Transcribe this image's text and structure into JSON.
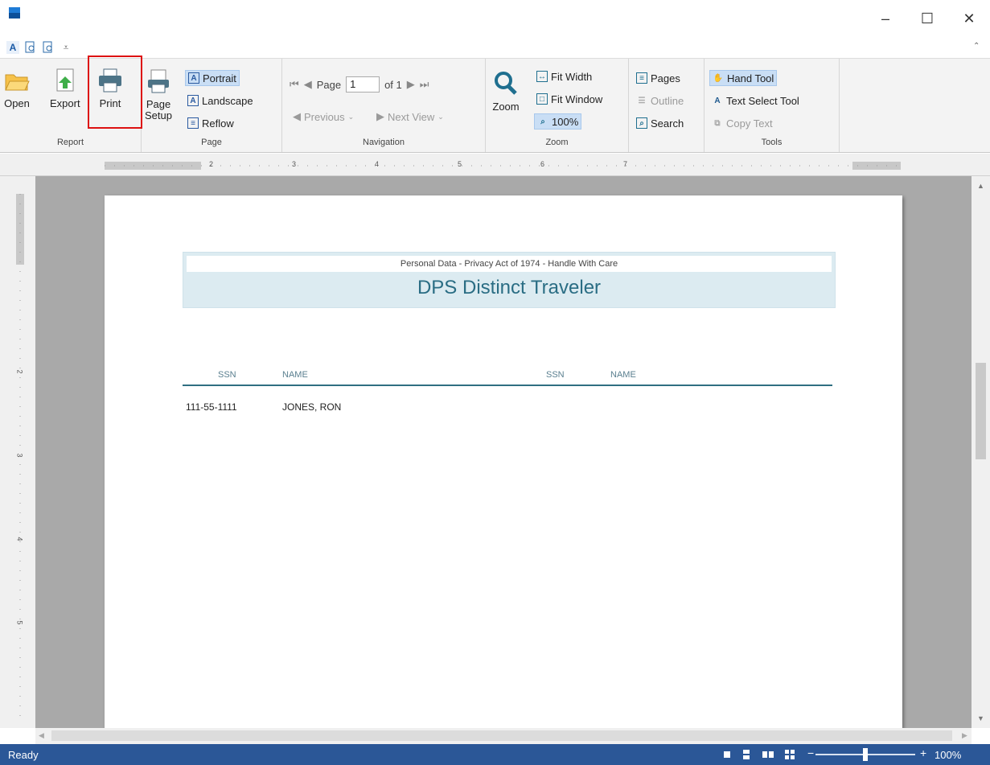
{
  "window": {
    "minimize": "–",
    "maximize": "☐",
    "close": "✕"
  },
  "ribbon": {
    "report": {
      "label": "Report",
      "open": "Open",
      "export": "Export",
      "print": "Print"
    },
    "page": {
      "label": "Page",
      "page_setup_1": "Page",
      "page_setup_2": "Setup",
      "portrait": "Portrait",
      "landscape": "Landscape",
      "reflow": "Reflow"
    },
    "navigation": {
      "label": "Navigation",
      "page_prefix": "Page",
      "page_value": "1",
      "page_of": "of 1",
      "previous_view": "Previous",
      "next_view": "Next View"
    },
    "zoom": {
      "label": "Zoom",
      "zoom": "Zoom",
      "fit_width": "Fit Width",
      "fit_window": "Fit Window",
      "zoom_100": "100%"
    },
    "view": {
      "pages": "Pages",
      "outline": "Outline",
      "search": "Search"
    },
    "tools": {
      "label": "Tools",
      "hand_tool": "Hand Tool",
      "text_select_tool": "Text Select Tool",
      "copy_text": "Copy Text"
    }
  },
  "ruler": {
    "h_marks": [
      "2",
      "3",
      "4",
      "5",
      "6",
      "7"
    ],
    "v_marks": [
      "2",
      "3",
      "4",
      "5"
    ]
  },
  "document": {
    "header_note": "Personal Data - Privacy Act of 1974 - Handle With Care",
    "title": "DPS Distinct Traveler",
    "columns": [
      "SSN",
      "NAME",
      "SSN",
      "NAME"
    ],
    "rows": [
      {
        "ssn": "111-55-1111",
        "name": "JONES, RON"
      }
    ]
  },
  "status": {
    "text": "Ready",
    "zoom": "100%",
    "zoom_level": 0.5
  }
}
